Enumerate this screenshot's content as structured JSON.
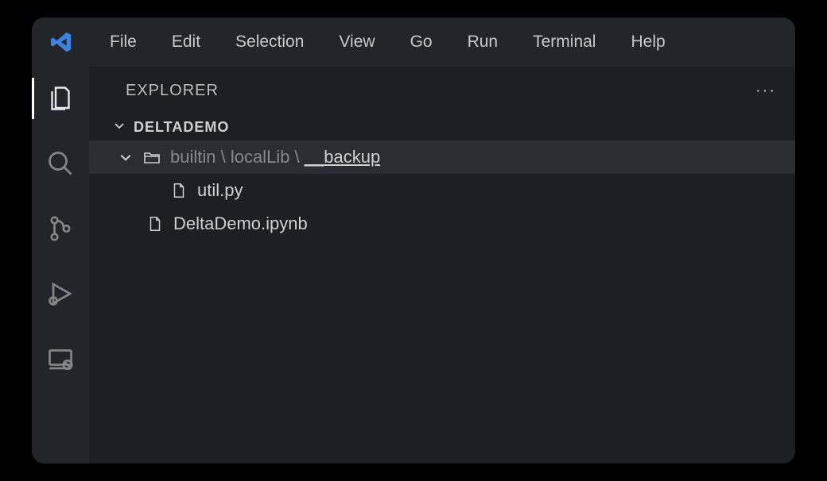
{
  "menu": {
    "file": "File",
    "edit": "Edit",
    "selection": "Selection",
    "view": "View",
    "go": "Go",
    "run": "Run",
    "terminal": "Terminal",
    "help": "Help"
  },
  "sidebar": {
    "title": "EXPLORER",
    "section": "DELTADEMO"
  },
  "tree": {
    "folder_path_prefix": "builtin \\ localLib \\ ",
    "folder_leaf": "__backup",
    "file1": "util.py",
    "file2": "DeltaDemo.ipynb"
  }
}
